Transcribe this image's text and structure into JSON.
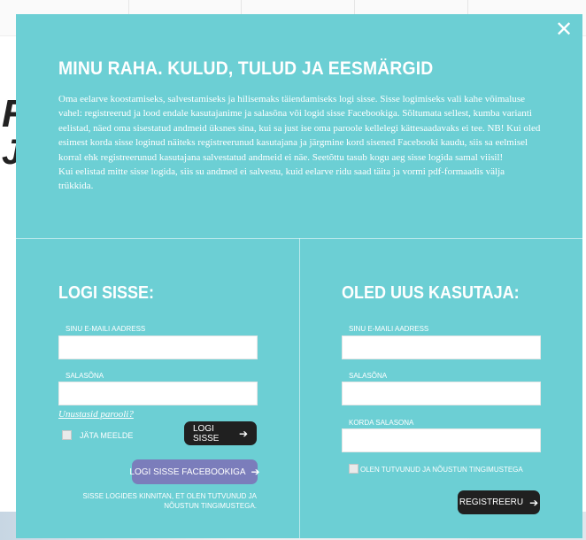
{
  "modal": {
    "close_glyph": "✕",
    "title": "MINU RAHA. KULUD, TULUD JA EESMÄRGID",
    "intro_p1": "Oma eelarve koostamiseks, salvestamiseks ja hilisemaks täiendamiseks logi sisse. Sisse logimiseks vali kahe võimaluse vahel: registreerud ja lood endale kasutajanime ja salasõna või logid sisse Facebookiga. Sõltumata sellest, kumba varianti eelistad, näed oma sisestatud andmeid üksnes sina, kui sa just ise oma paroole kellelegi kättesaadavaks ei tee. NB! Kui oled esimest korda sisse loginud näiteks registreerunud kasutajana ja järgmine kord sisened Facebooki kaudu, siis sa eelmisel korral ehk registreerunud kasutajana salvestatud andmeid ei näe. Seetõttu tasub kogu aeg sisse logida samal viisil!",
    "intro_p2": "Kui eelistad mitte sisse logida, siis su andmed ei salvestu, kuid eelarve ridu saad täita ja vormi pdf-formaadis välja trükkida."
  },
  "login": {
    "title": "LOGI SISSE:",
    "email_label": "SINU E-MAILI AADRESS",
    "password_label": "SALASÕNA",
    "forgot_link": "Unustasid parooli?",
    "remember_label": "JÄTA MEELDE",
    "submit_label": "LOGI SISSE",
    "facebook_label": "LOGI SISSE FACEBOOKIGA",
    "terms_note": "SISSE LOGIDES KINNITAN, ET OLEN TUTVUNUD JA NÕUSTUN TINGIMUSTEGA."
  },
  "register": {
    "title": "OLED UUS KASUTAJA:",
    "email_label": "SINU E-MAILI AADRESS",
    "password_label": "SALASÕNA",
    "repeat_password_label": "KORDA SALASONA",
    "terms_label": "OLEN TUTVUNUD JA NÕUSTUN TINGIMUSTEGA",
    "submit_label": "REGISTREERU"
  },
  "icons": {
    "arrow": "➔"
  },
  "colors": {
    "modal_bg": "#6ccfd4",
    "button_dark": "#202020",
    "button_facebook": "#7b7dbb"
  }
}
